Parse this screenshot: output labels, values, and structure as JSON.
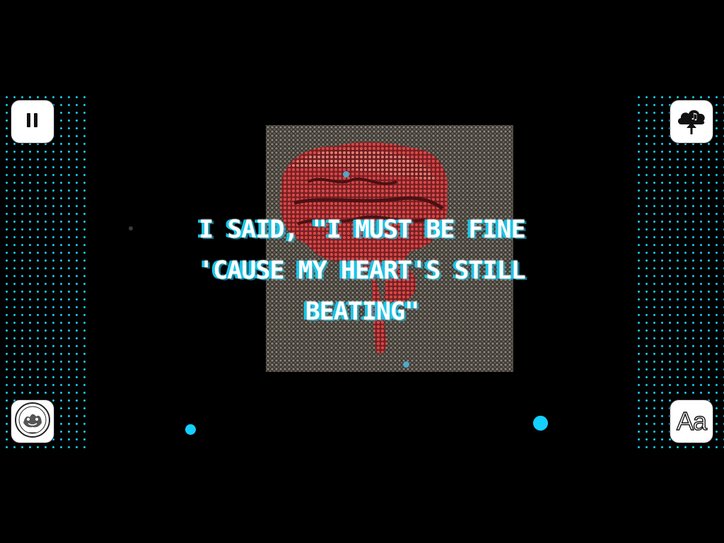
{
  "lyrics": {
    "line1": "I said, \"I must be fine",
    "line2": "'Cause my heart's still",
    "line3": "beating\""
  },
  "controls": {
    "pause_icon": "pause-icon",
    "upload_icon": "cloud-music-upload-icon",
    "badge_icon": "sticker-seal-icon",
    "font_label": "Aa"
  },
  "artwork": {
    "subject": "brain",
    "brain_color": "#c8403e"
  },
  "colors": {
    "accent": "#18c6e8",
    "background": "#000000",
    "button": "#ffffff"
  }
}
